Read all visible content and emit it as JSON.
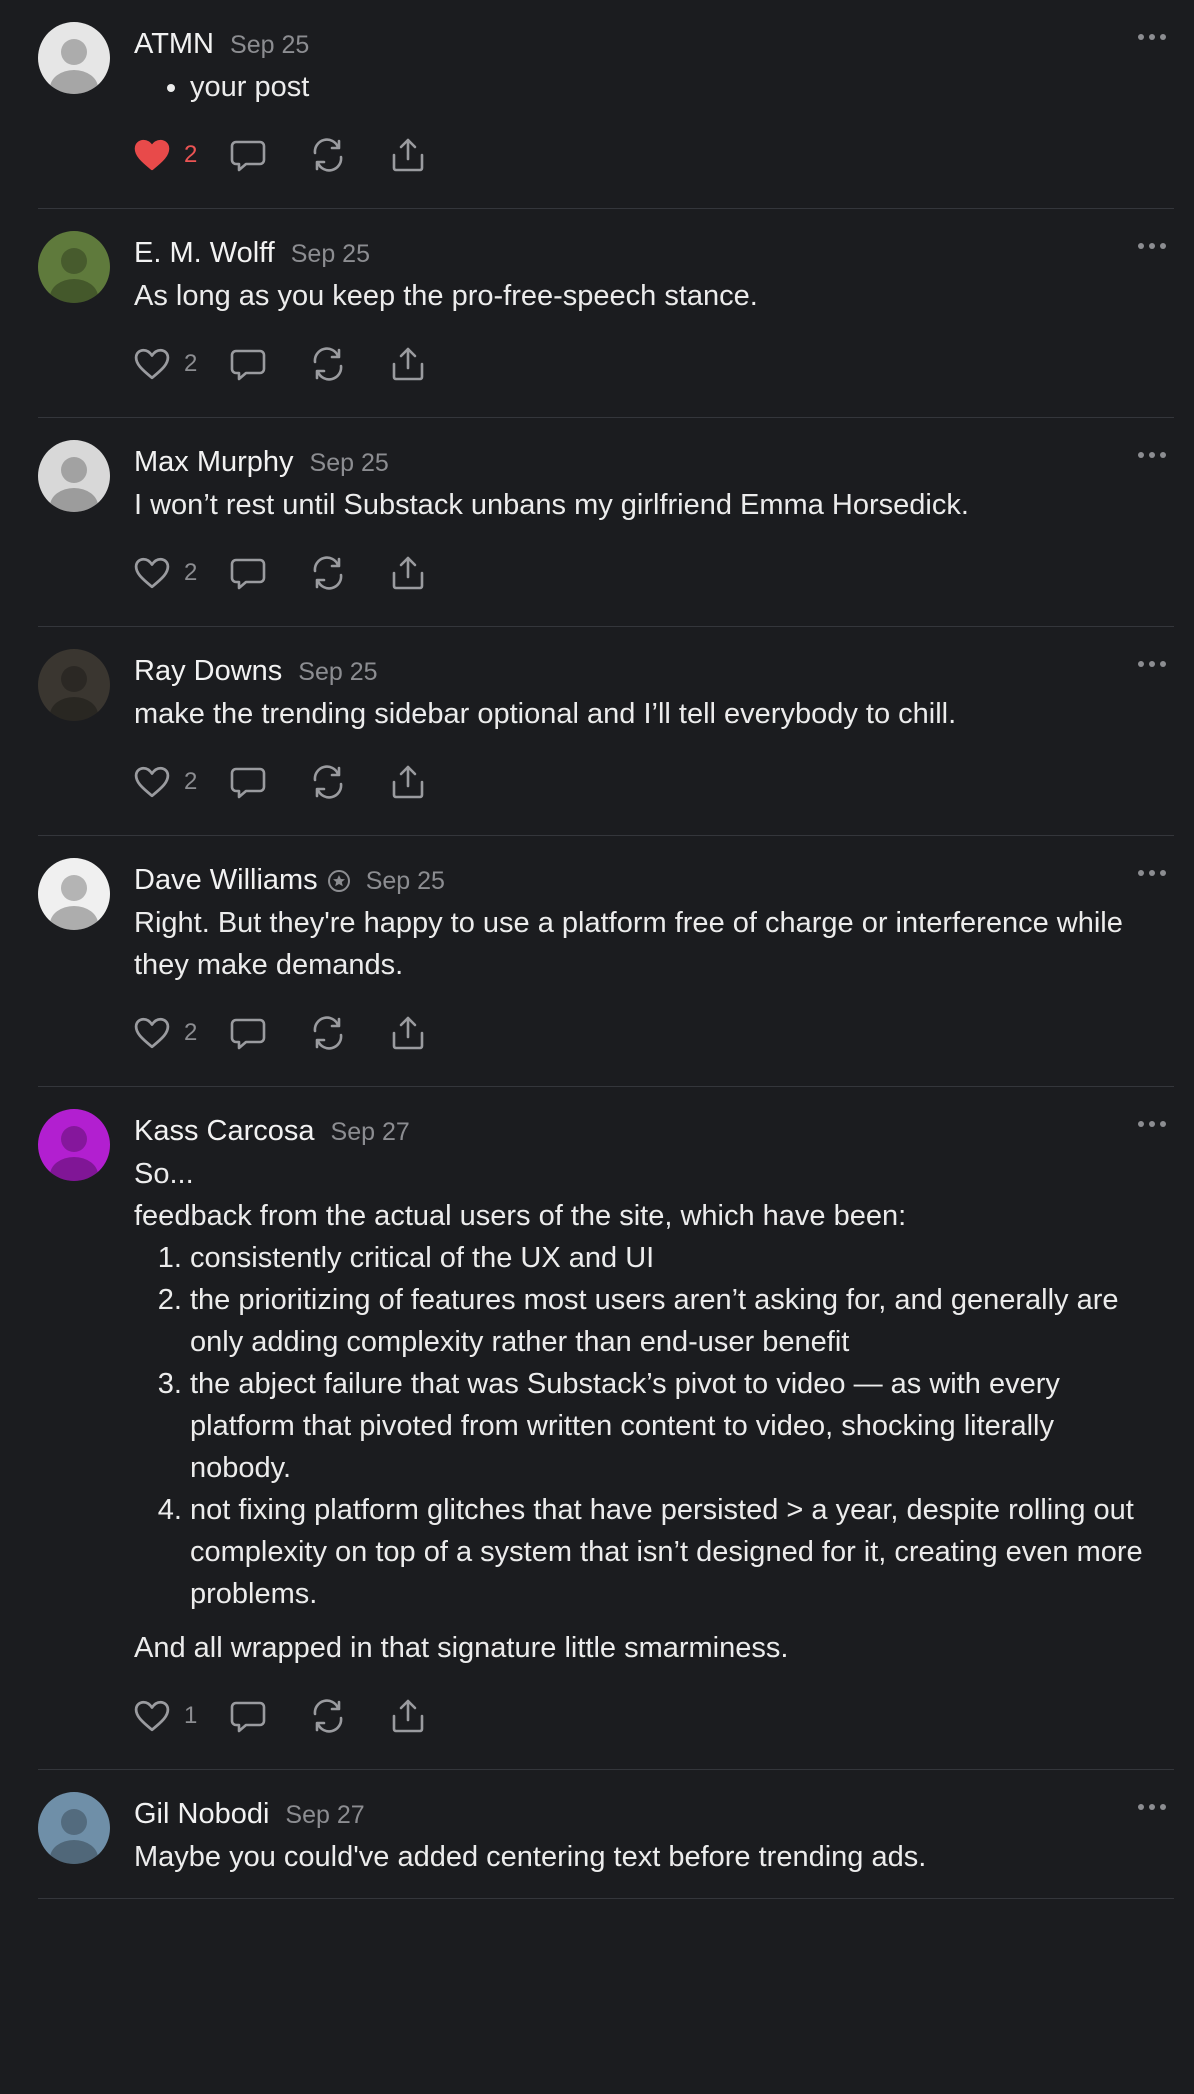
{
  "comments": [
    {
      "author": "ATMN",
      "date": "Sep 25",
      "likes": "2",
      "liked": true,
      "avatar_color": "#e6e6e6",
      "bullets": [
        "your post"
      ]
    },
    {
      "author": "E. M. Wolff",
      "date": "Sep 25",
      "likes": "2",
      "liked": false,
      "avatar_color": "#5f7a3c",
      "text": "As long as you keep the pro-free-speech stance."
    },
    {
      "author": "Max Murphy",
      "date": "Sep 25",
      "likes": "2",
      "liked": false,
      "avatar_color": "#d8d8d8",
      "text": "I won’t rest until Substack unbans my girlfriend Emma Horsedick."
    },
    {
      "author": "Ray Downs",
      "date": "Sep 25",
      "likes": "2",
      "liked": false,
      "avatar_color": "#3a3630",
      "text": "make the trending sidebar optional and I’ll tell everybody to chill."
    },
    {
      "author": "Dave Williams",
      "date": "Sep 25",
      "likes": "2",
      "liked": false,
      "verified": true,
      "avatar_color": "#f0f0f0",
      "text": "Right. But they're happy to use a platform free of charge or interference while they make demands."
    },
    {
      "author": "Kass Carcosa",
      "date": "Sep 27",
      "likes": "1",
      "liked": false,
      "avatar_color": "#b21fd0",
      "intro": [
        "So...",
        "feedback from the actual users of the site, which have been:"
      ],
      "list": [
        "consistently critical of the UX and UI",
        "the prioritizing of features most users aren’t asking for, and generally are only adding complexity rather than end-user benefit",
        "the abject failure that was Substack’s pivot to video — as with every platform that pivoted from written content to video, shocking literally nobody.",
        "not fixing platform glitches that have persisted > a year, despite rolling out complexity on top of a system that isn’t designed for it, creating even more problems."
      ],
      "outro": "And all wrapped in that signature little smarminess."
    },
    {
      "author": "Gil Nobodi",
      "date": "Sep 27",
      "avatar_color": "#6f8fa8",
      "text": "Maybe you could've added centering text before trending ads."
    }
  ],
  "icons": {
    "like": "heart-icon",
    "reply": "comment-bubble-icon",
    "restack": "restack-icon",
    "share": "share-icon",
    "more": "more-options-icon",
    "badge": "verified-badge-icon"
  },
  "colors": {
    "background": "#1b1c1f",
    "liked": "#ec5454",
    "muted": "#8c8d91"
  }
}
